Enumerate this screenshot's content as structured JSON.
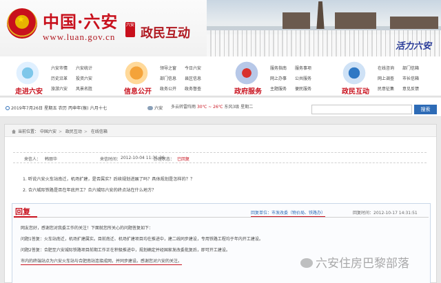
{
  "header": {
    "site_name": "中国·六安",
    "site_url": "www.luan.gov.cn",
    "seal_text": "六安",
    "section_title": "政民互动",
    "slogan": "活力六安"
  },
  "nav": [
    {
      "label": "走进六安",
      "icon": "city-icon",
      "links": [
        "六安市情",
        "六安统计",
        "历史沿革",
        "投资六安",
        "旅游六安",
        "风景名胜"
      ]
    },
    {
      "label": "信息公开",
      "icon": "gate-icon",
      "links": [
        "领导之窗",
        "今日六安",
        "部门信息",
        "县区信息",
        "政务公开",
        "政务督查"
      ]
    },
    {
      "label": "政府服务",
      "icon": "building-icon",
      "links": [
        "服务指南",
        "服务事项",
        "网上办事",
        "公共服务",
        "主题服务",
        "便民服务"
      ]
    },
    {
      "label": "政民互动",
      "icon": "mail-icon",
      "links": [
        "在线咨询",
        "部门信箱",
        "网上调查",
        "市长信箱",
        "民意征集",
        "意见反馈"
      ]
    }
  ],
  "infobar": {
    "date": "2019年7月26日 星期五 农历 丙申年(猴) 六月十七",
    "city": "六安",
    "weather": "多云转雷阵雨",
    "temperature": "30℃ ~ 26℃",
    "wind": "东风3级",
    "weekday": "星期二"
  },
  "search": {
    "placeholder": "",
    "button": "搜索"
  },
  "breadcrumb": [
    "当前位置：",
    "中国六安",
    "政民互动",
    "在线信箱"
  ],
  "meta": {
    "sender_label": "来信人：",
    "sender": "韩丽华",
    "time_label": "来信时间：",
    "time": "2012-10-04 11:31:36",
    "state_label": "办理状态：",
    "state": "已回复"
  },
  "questions": [
    "1. 听说六安火车站南迁，机场扩建，是否属实？后续规划进展了吗？具体规划是怎样的？？",
    "2. 合六城际铁路是否在年底开工？合六城际六安的终点站在什么地方？"
  ],
  "reply": {
    "title": "回复",
    "unit_label": "回复单位：",
    "unit": "市发改委（物价局、铁路办）",
    "time_label": "回复时间：",
    "time": "2012-10-17 14:31:51",
    "lines": [
      "网友您好，感谢您对我委工作的关注！下面就您所关心的问题答复如下：",
      "问题1答复：火车站南迁，机场扩建属实。目前南迁、机场扩建项目均在推进中，建二线同步建设，专用铁路工程均于年内开工建设。",
      "问题2答复：合肥至六安城际铁路项目前期工作正在积极推进中，规划确定并经国家发改委批复后，即可开工建设。",
      "市内的终端站点为六安火车站与合肥南站连接成网，并同步建设。感谢您对六安的关注。"
    ]
  },
  "watermark": "六安住房巴黎部落"
}
